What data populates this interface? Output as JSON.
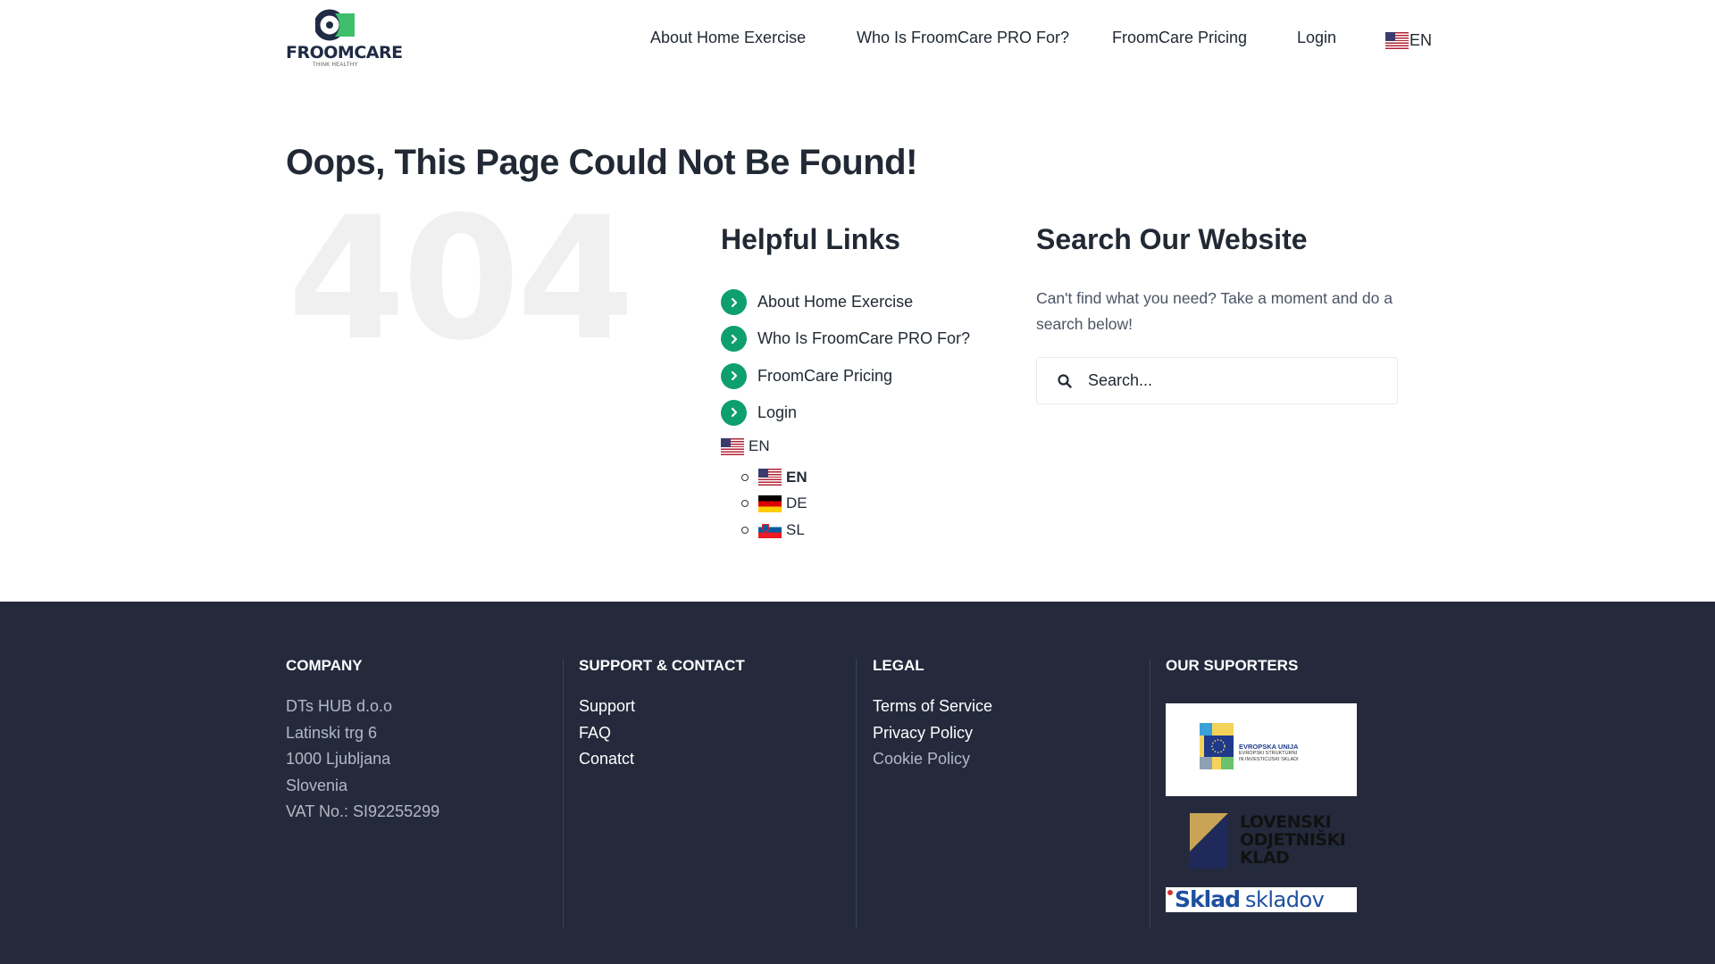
{
  "header": {
    "logo_text": "FROOMCARE",
    "logo_tagline": "THINK HEALTHY",
    "nav": [
      {
        "label": "About Home Exercise"
      },
      {
        "label": "Who Is FroomCare PRO For?"
      },
      {
        "label": "FroomCare Pricing"
      },
      {
        "label": "Login"
      }
    ],
    "language": "EN"
  },
  "main": {
    "title": "Oops, This Page Could Not Be Found!",
    "error_code": "404",
    "helpful_links": {
      "title": "Helpful Links",
      "items": [
        {
          "label": "About Home Exercise"
        },
        {
          "label": "Who Is FroomCare PRO For?"
        },
        {
          "label": "FroomCare Pricing"
        },
        {
          "label": "Login"
        }
      ],
      "language_current": "EN",
      "languages": [
        {
          "code": "EN",
          "flag": "us-flag-icon"
        },
        {
          "code": "DE",
          "flag": "de-flag-icon"
        },
        {
          "code": "SL",
          "flag": "sl-flag-icon"
        }
      ]
    },
    "search": {
      "title": "Search Our Website",
      "description": "Can't find what you need? Take a moment and do a search below!",
      "placeholder": "Search...",
      "value": ""
    }
  },
  "footer": {
    "company": {
      "heading": "COMPANY",
      "lines": [
        "DTs HUB d.o.o",
        "Latinski trg 6",
        "1000 Ljubljana",
        "Slovenia",
        "VAT No.: SI92255299"
      ]
    },
    "support": {
      "heading": "SUPPORT & CONTACT",
      "links": [
        "Support",
        "FAQ",
        "Conatct"
      ]
    },
    "legal": {
      "heading": "LEGAL",
      "links": [
        "Terms of Service",
        "Privacy Policy",
        "Cookie Policy"
      ]
    },
    "supporters": {
      "heading": "OUR SUPORTERS",
      "eu_title": "EVROPSKA UNIJA",
      "eu_sub1": "EVROPSKI STRUKTURNI",
      "eu_sub2": "IN INVESTICIJSKI SKLADI",
      "slo_lines": [
        "LOVENSKI",
        "ODJETNIŠKI",
        "KLAD"
      ],
      "sklad_a": "Sklad",
      "sklad_b": "skladov"
    }
  },
  "colors": {
    "accent_green": "#0e9f6e",
    "footer_bg": "#242a3c",
    "heading_text": "#212934"
  }
}
